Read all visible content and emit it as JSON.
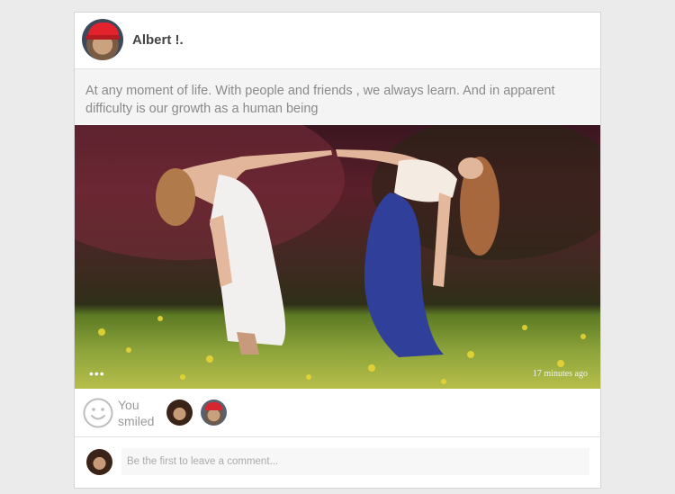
{
  "post": {
    "author": "Albert !.",
    "text": "At any moment of life. With  people and friends , we always learn. And in apparent difficulty is our growth as a human being",
    "timestamp": "17 minutes ago",
    "more_label": "•••"
  },
  "reactions": {
    "smile_label": "You smiled",
    "smile_icon": "smiley-face-icon",
    "reactor_avatars": [
      "avatar",
      "avatar"
    ]
  },
  "comment": {
    "placeholder": "Be the first to leave a comment..."
  },
  "colors": {
    "background": "#ebebeb",
    "card": "#ffffff",
    "muted_text": "#8a8a8a"
  }
}
